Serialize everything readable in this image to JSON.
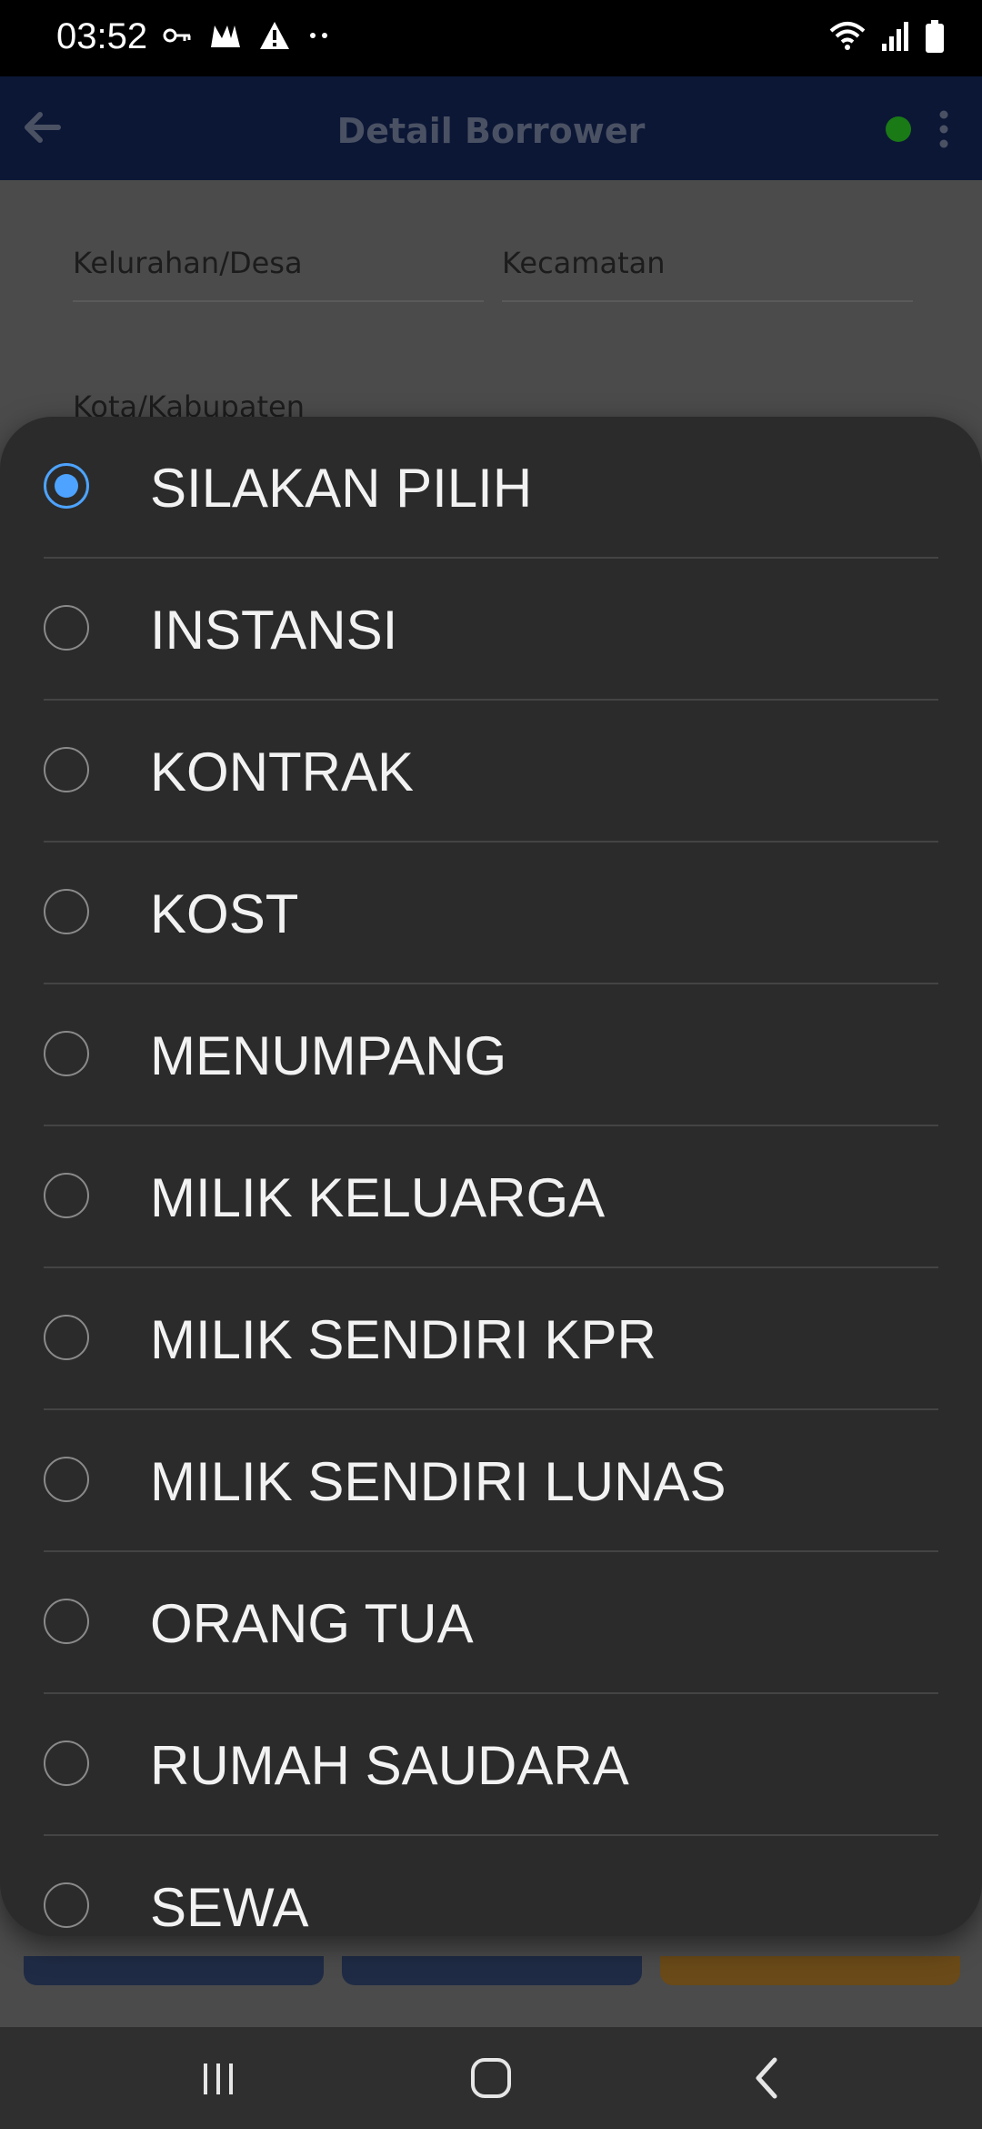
{
  "status_bar": {
    "time": "03:52",
    "left_icons": [
      "key-icon",
      "m-logo-icon",
      "warning-icon",
      "more-dots-icon"
    ],
    "right_icons": [
      "wifi-icon",
      "signal-icon",
      "battery-icon"
    ]
  },
  "app_bar": {
    "title": "Detail Borrower",
    "status_color": "#1a7a16"
  },
  "form": {
    "kelurahan_label": "Kelurahan/Desa",
    "kecamatan_label": "Kecamatan",
    "kota_label": "Kota/Kabupaten"
  },
  "dialog": {
    "selected_index": 0,
    "accent_color": "#4da3ff",
    "options": [
      "SILAKAN PILIH",
      "INSTANSI",
      "KONTRAK",
      "KOST",
      "MENUMPANG",
      "MILIK KELUARGA",
      "MILIK SENDIRI KPR",
      "MILIK SENDIRI LUNAS",
      "ORANG TUA",
      "RUMAH SAUDARA",
      "SEWA"
    ]
  },
  "nav_bar": {
    "buttons": [
      "recents-icon",
      "home-icon",
      "back-icon"
    ]
  }
}
